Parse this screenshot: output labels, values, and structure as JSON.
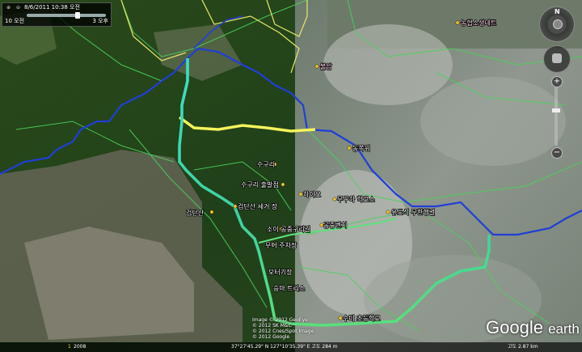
{
  "time_widget": {
    "date": "8/6/2011  10:38 오전",
    "start_label": "10 오전",
    "end_label": "3 오후"
  },
  "labels": [
    {
      "text": "농협소생네트",
      "style": "pink"
    },
    {
      "text": "불암",
      "style": "pink"
    },
    {
      "text": "동쪽위",
      "style": "white"
    },
    {
      "text": "수구리",
      "style": "white"
    },
    {
      "text": "수구리 출발점",
      "style": "white"
    },
    {
      "text": "하이오",
      "style": "white"
    },
    {
      "text": "무구하 학교스",
      "style": "white"
    },
    {
      "text": "검단산",
      "style": "white"
    },
    {
      "text": "검단산 세거 장",
      "style": "white"
    },
    {
      "text": "소이 공중",
      "style": "white"
    },
    {
      "text": "구리길",
      "style": "white"
    },
    {
      "text": "공중벤치",
      "style": "white"
    },
    {
      "text": "유도식 무한행렬",
      "style": "white"
    },
    {
      "text": "무어 주차장",
      "style": "white"
    },
    {
      "text": "모터기장",
      "style": "white"
    },
    {
      "text": "승마 트리스",
      "style": "white"
    },
    {
      "text": "수미 초등학교",
      "style": "white"
    }
  ],
  "copyright": [
    "Image © 2012 GeoEye",
    "© 2012 SK M&C",
    "© 2012 Cnes/Spot Image",
    "© 2012 Google"
  ],
  "logo": {
    "google": "Google",
    "earth": "earth"
  },
  "status_bar": {
    "tour_label": "1",
    "year": "2008",
    "coordinates": "37°27'45.29\" N 127°10'35.39\" E  고도 284 m",
    "eye_alt": "고도 2.87 km"
  },
  "route_colors": {
    "blue": "#1f3fd8",
    "yellow": "#f4f35a",
    "cyan": "#3fd9b3",
    "green": "#4ad25a",
    "trail": "#dde04a"
  }
}
